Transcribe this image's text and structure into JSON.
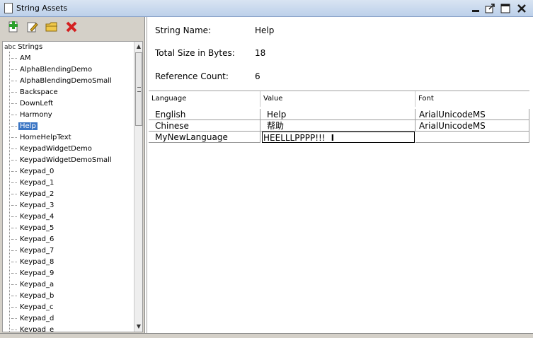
{
  "window": {
    "title": "String Assets"
  },
  "toolbar": {
    "add_icon": "add-plus-icon",
    "edit_icon": "pencil-edit-icon",
    "folder_icon": "folder-icon",
    "delete_icon": "red-x-delete-icon"
  },
  "tree": {
    "root_prefix": "abc",
    "root_label": "Strings",
    "items": [
      "AM",
      "AlphaBlendingDemo",
      "AlphaBlendingDemoSmall",
      "Backspace",
      "DownLeft",
      "Harmony",
      "Help",
      "HomeHelpText",
      "KeypadWidgetDemo",
      "KeypadWidgetDemoSmall",
      "Keypad_0",
      "Keypad_1",
      "Keypad_2",
      "Keypad_3",
      "Keypad_4",
      "Keypad_5",
      "Keypad_6",
      "Keypad_7",
      "Keypad_8",
      "Keypad_9",
      "Keypad_a",
      "Keypad_b",
      "Keypad_c",
      "Keypad_d",
      "Keypad_e"
    ],
    "selected": "Help"
  },
  "details": {
    "string_name_label": "String Name:",
    "string_name_value": "Help",
    "total_size_label": "Total Size in Bytes:",
    "total_size_value": "18",
    "ref_count_label": "Reference Count:",
    "ref_count_value": "6"
  },
  "table": {
    "columns": [
      "Language",
      "Value",
      "Font"
    ],
    "rows": [
      {
        "language": "English",
        "value": "Help",
        "font": "ArialUnicodeMS"
      },
      {
        "language": "Chinese",
        "value": "帮助",
        "font": "ArialUnicodeMS"
      },
      {
        "language": "MyNewLanguage",
        "value": "HEELLLPPPP!!!",
        "font": ""
      }
    ]
  },
  "colors": {
    "selection": "#3a75c4",
    "titlebar": "#bcd0ea",
    "panel": "#d4d0c8"
  }
}
